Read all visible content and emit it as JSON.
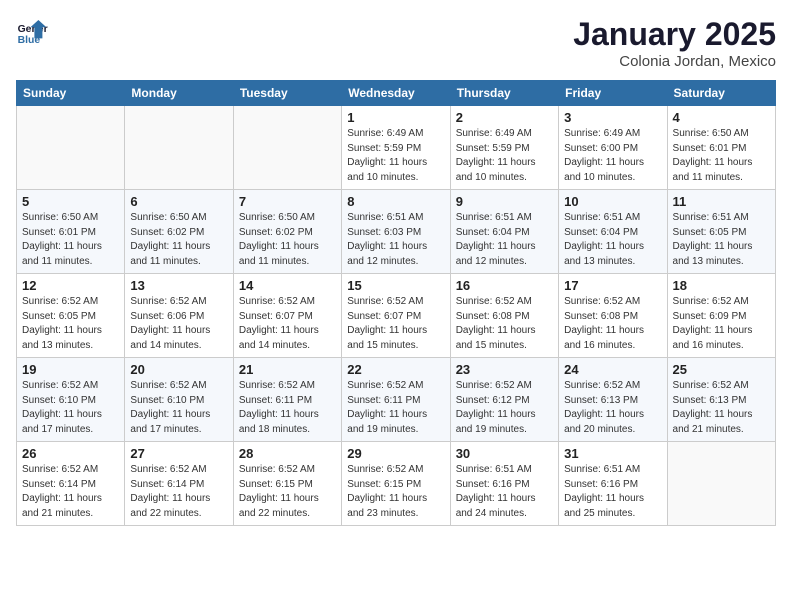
{
  "logo": {
    "line1": "General",
    "line2": "Blue"
  },
  "title": "January 2025",
  "subtitle": "Colonia Jordan, Mexico",
  "days_of_week": [
    "Sunday",
    "Monday",
    "Tuesday",
    "Wednesday",
    "Thursday",
    "Friday",
    "Saturday"
  ],
  "weeks": [
    [
      {
        "day": "",
        "info": ""
      },
      {
        "day": "",
        "info": ""
      },
      {
        "day": "",
        "info": ""
      },
      {
        "day": "1",
        "info": "Sunrise: 6:49 AM\nSunset: 5:59 PM\nDaylight: 11 hours and 10 minutes."
      },
      {
        "day": "2",
        "info": "Sunrise: 6:49 AM\nSunset: 5:59 PM\nDaylight: 11 hours and 10 minutes."
      },
      {
        "day": "3",
        "info": "Sunrise: 6:49 AM\nSunset: 6:00 PM\nDaylight: 11 hours and 10 minutes."
      },
      {
        "day": "4",
        "info": "Sunrise: 6:50 AM\nSunset: 6:01 PM\nDaylight: 11 hours and 11 minutes."
      }
    ],
    [
      {
        "day": "5",
        "info": "Sunrise: 6:50 AM\nSunset: 6:01 PM\nDaylight: 11 hours and 11 minutes."
      },
      {
        "day": "6",
        "info": "Sunrise: 6:50 AM\nSunset: 6:02 PM\nDaylight: 11 hours and 11 minutes."
      },
      {
        "day": "7",
        "info": "Sunrise: 6:50 AM\nSunset: 6:02 PM\nDaylight: 11 hours and 11 minutes."
      },
      {
        "day": "8",
        "info": "Sunrise: 6:51 AM\nSunset: 6:03 PM\nDaylight: 11 hours and 12 minutes."
      },
      {
        "day": "9",
        "info": "Sunrise: 6:51 AM\nSunset: 6:04 PM\nDaylight: 11 hours and 12 minutes."
      },
      {
        "day": "10",
        "info": "Sunrise: 6:51 AM\nSunset: 6:04 PM\nDaylight: 11 hours and 13 minutes."
      },
      {
        "day": "11",
        "info": "Sunrise: 6:51 AM\nSunset: 6:05 PM\nDaylight: 11 hours and 13 minutes."
      }
    ],
    [
      {
        "day": "12",
        "info": "Sunrise: 6:52 AM\nSunset: 6:05 PM\nDaylight: 11 hours and 13 minutes."
      },
      {
        "day": "13",
        "info": "Sunrise: 6:52 AM\nSunset: 6:06 PM\nDaylight: 11 hours and 14 minutes."
      },
      {
        "day": "14",
        "info": "Sunrise: 6:52 AM\nSunset: 6:07 PM\nDaylight: 11 hours and 14 minutes."
      },
      {
        "day": "15",
        "info": "Sunrise: 6:52 AM\nSunset: 6:07 PM\nDaylight: 11 hours and 15 minutes."
      },
      {
        "day": "16",
        "info": "Sunrise: 6:52 AM\nSunset: 6:08 PM\nDaylight: 11 hours and 15 minutes."
      },
      {
        "day": "17",
        "info": "Sunrise: 6:52 AM\nSunset: 6:08 PM\nDaylight: 11 hours and 16 minutes."
      },
      {
        "day": "18",
        "info": "Sunrise: 6:52 AM\nSunset: 6:09 PM\nDaylight: 11 hours and 16 minutes."
      }
    ],
    [
      {
        "day": "19",
        "info": "Sunrise: 6:52 AM\nSunset: 6:10 PM\nDaylight: 11 hours and 17 minutes."
      },
      {
        "day": "20",
        "info": "Sunrise: 6:52 AM\nSunset: 6:10 PM\nDaylight: 11 hours and 17 minutes."
      },
      {
        "day": "21",
        "info": "Sunrise: 6:52 AM\nSunset: 6:11 PM\nDaylight: 11 hours and 18 minutes."
      },
      {
        "day": "22",
        "info": "Sunrise: 6:52 AM\nSunset: 6:11 PM\nDaylight: 11 hours and 19 minutes."
      },
      {
        "day": "23",
        "info": "Sunrise: 6:52 AM\nSunset: 6:12 PM\nDaylight: 11 hours and 19 minutes."
      },
      {
        "day": "24",
        "info": "Sunrise: 6:52 AM\nSunset: 6:13 PM\nDaylight: 11 hours and 20 minutes."
      },
      {
        "day": "25",
        "info": "Sunrise: 6:52 AM\nSunset: 6:13 PM\nDaylight: 11 hours and 21 minutes."
      }
    ],
    [
      {
        "day": "26",
        "info": "Sunrise: 6:52 AM\nSunset: 6:14 PM\nDaylight: 11 hours and 21 minutes."
      },
      {
        "day": "27",
        "info": "Sunrise: 6:52 AM\nSunset: 6:14 PM\nDaylight: 11 hours and 22 minutes."
      },
      {
        "day": "28",
        "info": "Sunrise: 6:52 AM\nSunset: 6:15 PM\nDaylight: 11 hours and 22 minutes."
      },
      {
        "day": "29",
        "info": "Sunrise: 6:52 AM\nSunset: 6:15 PM\nDaylight: 11 hours and 23 minutes."
      },
      {
        "day": "30",
        "info": "Sunrise: 6:51 AM\nSunset: 6:16 PM\nDaylight: 11 hours and 24 minutes."
      },
      {
        "day": "31",
        "info": "Sunrise: 6:51 AM\nSunset: 6:16 PM\nDaylight: 11 hours and 25 minutes."
      },
      {
        "day": "",
        "info": ""
      }
    ]
  ]
}
